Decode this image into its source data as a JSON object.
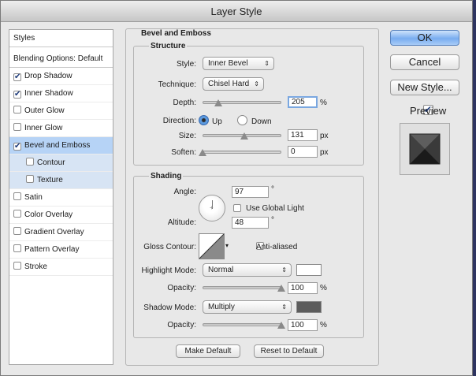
{
  "window": {
    "title": "Layer Style"
  },
  "styles_list": {
    "header": "Styles",
    "blending": "Blending Options: Default",
    "items": [
      {
        "label": "Drop Shadow",
        "checked": true
      },
      {
        "label": "Inner Shadow",
        "checked": true
      },
      {
        "label": "Outer Glow",
        "checked": false
      },
      {
        "label": "Inner Glow",
        "checked": false
      },
      {
        "label": "Bevel and Emboss",
        "checked": true
      },
      {
        "label": "Contour",
        "checked": false
      },
      {
        "label": "Texture",
        "checked": false
      },
      {
        "label": "Satin",
        "checked": false
      },
      {
        "label": "Color Overlay",
        "checked": false
      },
      {
        "label": "Gradient Overlay",
        "checked": false
      },
      {
        "label": "Pattern Overlay",
        "checked": false
      },
      {
        "label": "Stroke",
        "checked": false
      }
    ]
  },
  "bevel": {
    "title": "Bevel and Emboss",
    "structure": {
      "title": "Structure",
      "style_label": "Style:",
      "style_value": "Inner Bevel",
      "technique_label": "Technique:",
      "technique_value": "Chisel Hard",
      "depth_label": "Depth:",
      "depth_value": "205",
      "depth_unit": "%",
      "depth_level": 0.2,
      "direction_label": "Direction:",
      "direction_up": "Up",
      "direction_down": "Down",
      "direction_selected": "Up",
      "size_label": "Size:",
      "size_value": "131",
      "size_unit": "px",
      "size_level": 0.53,
      "soften_label": "Soften:",
      "soften_value": "0",
      "soften_unit": "px",
      "soften_level": 0.0
    },
    "shading": {
      "title": "Shading",
      "angle_label": "Angle:",
      "angle_value": "97",
      "angle_unit": "°",
      "global_light_label": "Use Global Light",
      "global_light_checked": false,
      "altitude_label": "Altitude:",
      "altitude_value": "48",
      "altitude_unit": "°",
      "gloss_label": "Gloss Contour:",
      "anti_aliased_label": "Anti-aliased",
      "anti_aliased_checked": false,
      "highlight_label": "Highlight Mode:",
      "highlight_mode": "Normal",
      "highlight_color": "#ffffff",
      "highlight_opacity_label": "Opacity:",
      "highlight_opacity": "100",
      "highlight_opacity_unit": "%",
      "highlight_opacity_level": 1.0,
      "shadow_label": "Shadow Mode:",
      "shadow_mode": "Multiply",
      "shadow_color": "#5c5c5c",
      "shadow_opacity_label": "Opacity:",
      "shadow_opacity": "100",
      "shadow_opacity_unit": "%",
      "shadow_opacity_level": 1.0
    },
    "make_default": "Make Default",
    "reset_default": "Reset to Default"
  },
  "buttons": {
    "ok": "OK",
    "cancel": "Cancel",
    "new_style": "New Style...",
    "preview_label": "Preview",
    "preview_checked": true
  }
}
